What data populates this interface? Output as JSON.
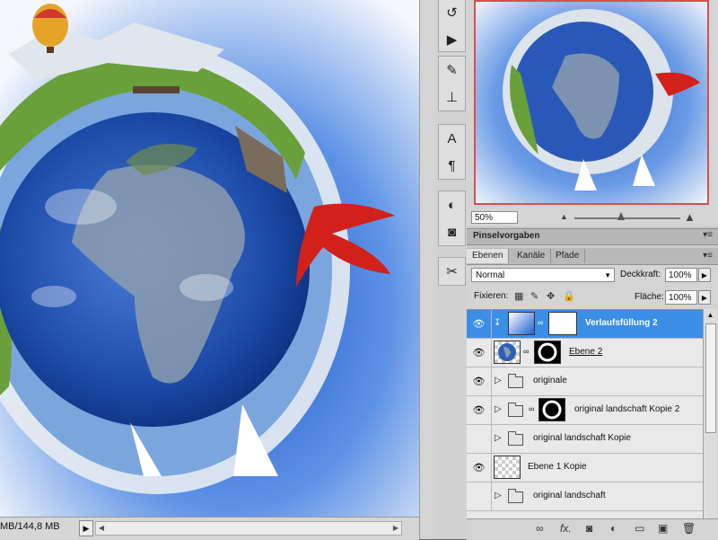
{
  "status_bar": {
    "doc_size": "MB/144,8 MB"
  },
  "navigator": {
    "zoom": "50%"
  },
  "panels": {
    "brush_presets_title": "Pinselvorgaben"
  },
  "layers": {
    "tabs": [
      "Ebenen",
      "Kanäle",
      "Pfade"
    ],
    "blend_mode": "Normal",
    "opacity_label": "Deckkraft:",
    "opacity_value": "100%",
    "lock_label": "Fixieren:",
    "fill_label": "Fläche:",
    "fill_value": "100%",
    "items": [
      {
        "name": "Verlaufsfüllung 2",
        "visible": true,
        "selected": true,
        "type": "gradient-fill"
      },
      {
        "name": "Ebene 2",
        "visible": true,
        "selected": false,
        "type": "layer-mask"
      },
      {
        "name": "originale",
        "visible": true,
        "selected": false,
        "type": "group"
      },
      {
        "name": "original landschaft Kopie 2",
        "visible": true,
        "selected": false,
        "type": "group-mask"
      },
      {
        "name": "original landschaft Kopie",
        "visible": false,
        "selected": false,
        "type": "group"
      },
      {
        "name": "Ebene 1 Kopie",
        "visible": true,
        "selected": false,
        "type": "layer"
      },
      {
        "name": "original landschaft",
        "visible": false,
        "selected": false,
        "type": "group"
      }
    ]
  },
  "icons": {
    "tools": [
      "history-icon",
      "actions-icon",
      "brush-icon",
      "stamp-icon",
      "character-icon",
      "paragraph-icon",
      "adjustments-icon",
      "masks-icon",
      "tools-icon"
    ],
    "bottom": [
      "link-layers-icon",
      "fx-icon",
      "add-mask-icon",
      "adjustment-layer-icon",
      "new-group-icon",
      "new-layer-icon",
      "trash-icon"
    ]
  }
}
